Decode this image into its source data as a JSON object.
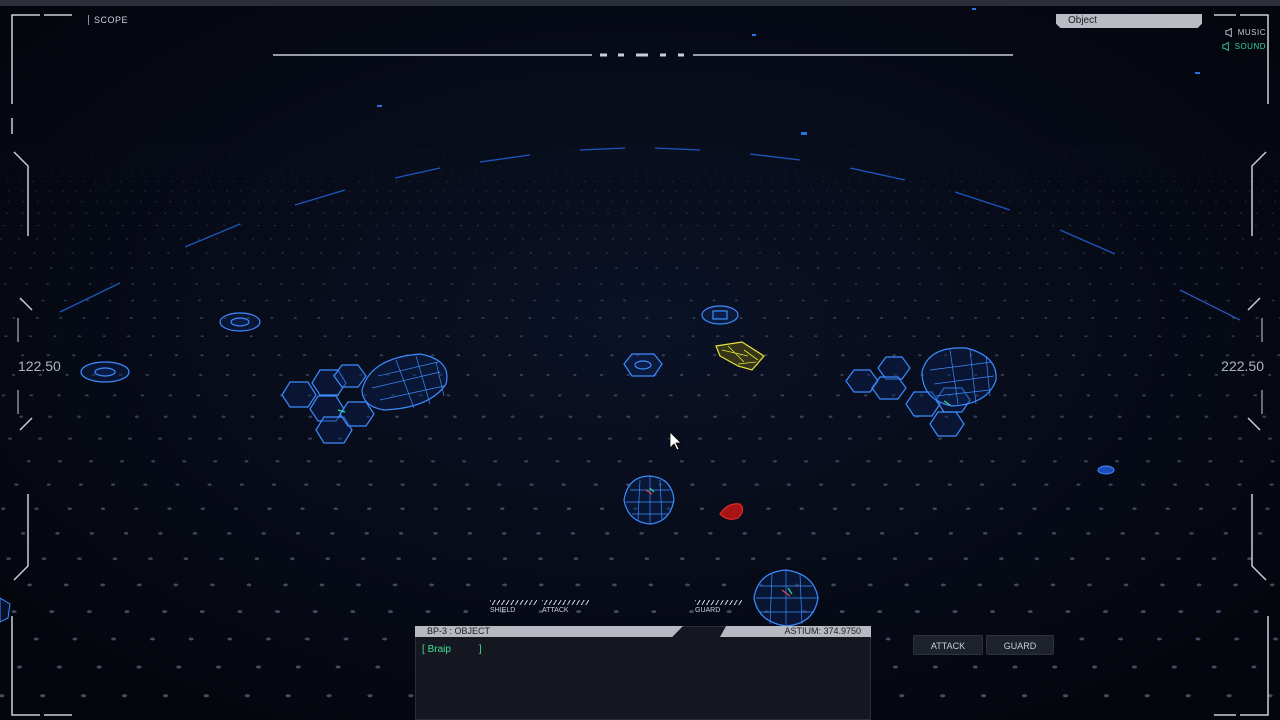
{
  "hud": {
    "scope_label": "SCOPE",
    "coord_left": "122.50",
    "coord_right": "222.50",
    "object_tab": "Object",
    "audio": {
      "music": "MUSIC",
      "sound": "SOUND"
    },
    "ability_labels": {
      "shield": "SHIELD",
      "attack": "ATTACK",
      "guard": "GUARD"
    }
  },
  "selection_panel": {
    "title": "BP-3 : OBJECT",
    "resource": "ASTIUM: 374.9750",
    "units": [
      {
        "name": "Braip"
      }
    ]
  },
  "commands": {
    "attack": "ATTACK",
    "guard": "GUARD"
  },
  "colors": {
    "background": "#05070f",
    "wireframe_blue": "#3d8bff",
    "hud_grey": "#c9ced8",
    "accent_green": "#33d39a",
    "ally_yellow": "#e8e43a",
    "enemy_red": "#e02a2a"
  }
}
